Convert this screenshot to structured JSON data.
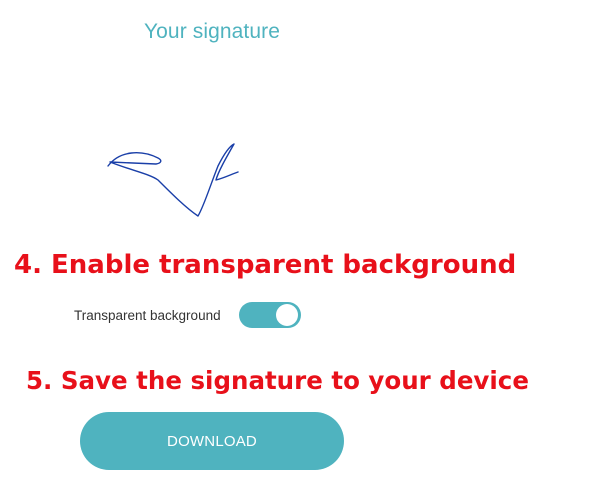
{
  "heading": "Your signature",
  "step_4": "4. Enable transparent background",
  "toggle": {
    "label": "Transparent background",
    "on": true
  },
  "step_5": "5. Save the signature to your device",
  "download_label": "DOWNLOAD",
  "colors": {
    "accent": "#4fb3bf",
    "instruction": "#e8101a",
    "ink": "#1a3fa8"
  }
}
